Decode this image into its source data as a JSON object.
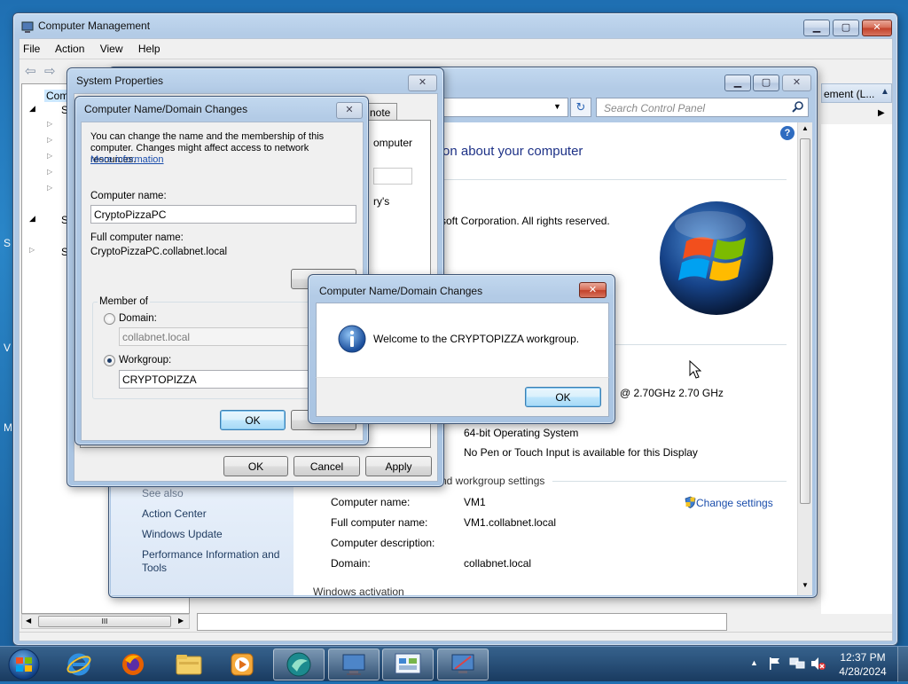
{
  "desktop": {
    "edge_chars": [
      "S",
      "V",
      "M"
    ]
  },
  "computer_management": {
    "title": "Computer Management",
    "menu": [
      "File",
      "Action",
      "View",
      "Help"
    ],
    "tree": {
      "root_partial": "Comp",
      "system_tools_partial": "Sy",
      "storage_partial": "St",
      "services_partial": "Se"
    },
    "actions_partial": "ement (L...",
    "hscroll_thumb": "III"
  },
  "control_panel": {
    "search_placeholder": "Search Control Panel",
    "heading_partial": "on about your computer",
    "copyright_partial": "soft Corporation.  All rights reserved.",
    "processor_partial": "@ 2.70GHz   2.70 GHz",
    "system_type": "64-bit Operating System",
    "pen_touch": "No Pen or Touch Input is available for this Display",
    "section_partial": "nd workgroup settings",
    "rows": [
      {
        "label": "Computer name:",
        "value": "VM1"
      },
      {
        "label": "Full computer name:",
        "value": "VM1.collabnet.local"
      },
      {
        "label": "Computer description:",
        "value": ""
      },
      {
        "label": "Domain:",
        "value": "collabnet.local"
      }
    ],
    "change_settings": "Change settings",
    "see_also": "See also",
    "see_also_links": [
      "Action Center",
      "Windows Update",
      "Performance Information and Tools"
    ],
    "bottom_cut": "Windows activation"
  },
  "system_properties": {
    "title": "System Properties",
    "tab_partial": "note",
    "text_partial_1": "omputer",
    "text_partial_2": "ry's",
    "ok": "OK",
    "cancel": "Cancel",
    "apply": "Apply"
  },
  "name_changes": {
    "title": "Computer Name/Domain Changes",
    "description": "You can change the name and the membership of this computer. Changes might affect access to network resources.",
    "more_info": "More information",
    "computer_name_label": "Computer name:",
    "computer_name_value": "CryptoPizzaPC",
    "full_name_label": "Full computer name:",
    "full_name_value": "CryptoPizzaPC.collabnet.local",
    "member_of": "Member of",
    "domain_label": "Domain:",
    "domain_value": "collabnet.local",
    "workgroup_label": "Workgroup:",
    "workgroup_value": "CRYPTOPIZZA",
    "ok": "OK"
  },
  "message_box": {
    "title": "Computer Name/Domain Changes",
    "message": "Welcome to the CRYPTOPIZZA workgroup.",
    "ok": "OK"
  },
  "taskbar": {
    "apps": [
      "start-orb",
      "internet-explorer",
      "firefox",
      "windows-explorer",
      "media-player",
      "unknown-app",
      "computer-management",
      "control-panel",
      "system-properties"
    ],
    "time": "12:37 PM",
    "date": "4/28/2024"
  }
}
